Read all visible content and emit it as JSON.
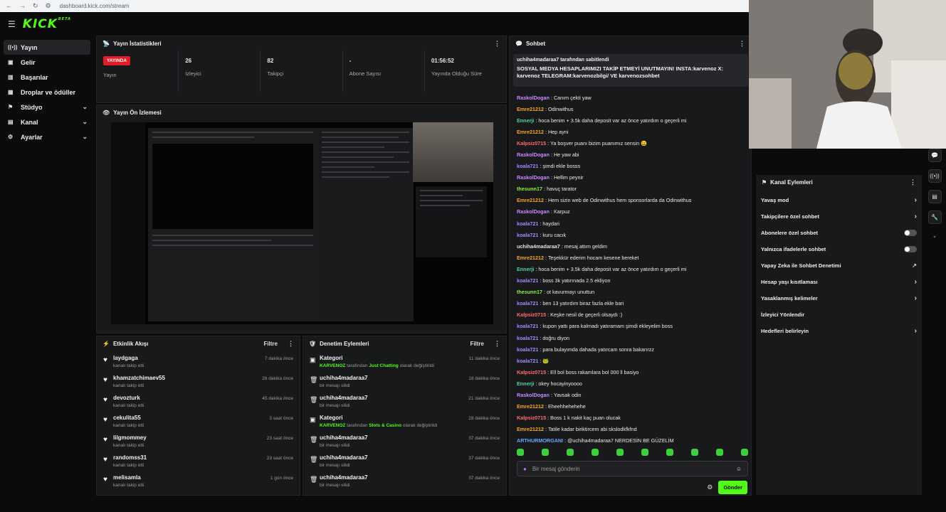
{
  "browser": {
    "url": "dashboard.kick.com/stream"
  },
  "brand": {
    "logo": "KICK",
    "beta": "BETA"
  },
  "sidebar": {
    "items": [
      {
        "label": "Yayın",
        "icon": "broadcast-icon",
        "chevron": false,
        "active": true
      },
      {
        "label": "Gelir",
        "icon": "revenue-icon",
        "chevron": false
      },
      {
        "label": "Başarılar",
        "icon": "chart-icon",
        "chevron": false
      },
      {
        "label": "Droplar ve ödüller",
        "icon": "drops-icon",
        "chevron": false
      },
      {
        "label": "Stüdyo",
        "icon": "studio-icon",
        "chevron": true
      },
      {
        "label": "Kanal",
        "icon": "channel-icon",
        "chevron": true
      },
      {
        "label": "Ayarlar",
        "icon": "gear-icon",
        "chevron": true
      }
    ]
  },
  "stats": {
    "title": "Yayın İstatistikleri",
    "items": [
      {
        "value": "YAYINDA",
        "label": "Yayın",
        "badge": true
      },
      {
        "value": "26",
        "label": "İzleyici"
      },
      {
        "value": "82",
        "label": "Takipçi"
      },
      {
        "value": "-",
        "label": "Abone Sayısı"
      },
      {
        "value": "01:56:52",
        "label": "Yayında Olduğu Süre"
      }
    ]
  },
  "preview": {
    "title": "Yayın Ön İzlemesi"
  },
  "activity": {
    "title": "Etkinlik Akışı",
    "filter": "Filtre",
    "rows": [
      {
        "name": "laydgaga",
        "action": "kanalı takip etti",
        "time": "7 dakika önce"
      },
      {
        "name": "khamzatchimaev55",
        "action": "kanalı takip etti",
        "time": "26 dakika önce"
      },
      {
        "name": "devozturk",
        "action": "kanalı takip etti",
        "time": "45 dakika önce"
      },
      {
        "name": "cekulita55",
        "action": "kanalı takip etti",
        "time": "3 saat önce"
      },
      {
        "name": "lilgmommey",
        "action": "kanalı takip etti",
        "time": "23 saat önce"
      },
      {
        "name": "randomss31",
        "action": "kanalı takip etti",
        "time": "23 saat önce"
      },
      {
        "name": "melisamla",
        "action": "kanalı takip etti",
        "time": "1 gün önce"
      }
    ]
  },
  "moderation": {
    "title": "Denetim Eylemleri",
    "filter": "Filtre",
    "rows": [
      {
        "name": "Kategori",
        "icon": "category-icon",
        "pre": "KARVENOZ",
        "mid": " tarafından ",
        "hl": "Just Chatting",
        "post": " olarak değiştirildi",
        "time": "11 dakika önce"
      },
      {
        "name": "uchiha4madaraa7",
        "icon": "trash-icon",
        "pre": "",
        "mid": "bir mesajı silidi",
        "hl": "",
        "post": "",
        "time": "18 dakika önce"
      },
      {
        "name": "uchiha4madaraa7",
        "icon": "trash-icon",
        "pre": "",
        "mid": "bir mesajı silidi",
        "hl": "",
        "post": "",
        "time": "21 dakika önce"
      },
      {
        "name": "Kategori",
        "icon": "category-icon",
        "pre": "KARVENOZ",
        "mid": " tarafından ",
        "hl": "Slots & Casino",
        "post": " olarak değiştirildi",
        "time": "28 dakika önce"
      },
      {
        "name": "uchiha4madaraa7",
        "icon": "trash-icon",
        "pre": "",
        "mid": "bir mesajı silidi",
        "hl": "",
        "post": "",
        "time": "37 dakika önce"
      },
      {
        "name": "uchiha4madaraa7",
        "icon": "trash-icon",
        "pre": "",
        "mid": "bir mesajı silidi",
        "hl": "",
        "post": "",
        "time": "37 dakika önce"
      },
      {
        "name": "uchiha4madaraa7",
        "icon": "trash-icon",
        "pre": "",
        "mid": "bir mesajı silidi",
        "hl": "",
        "post": "",
        "time": "37 dakika önce"
      }
    ]
  },
  "chat": {
    "title": "Sohbet",
    "pinned": {
      "by": "uchiha4madaraa7 tarafından sabitlendi",
      "message": "SOSYAL MEDYA HESAPLARIMIZI TAKİP ETMEYİ UNUTMAYIN! INSTA:karvenoz X: karvenoz TELEGRAM:karvenozbilgi/ VE karvenozsohbet"
    },
    "messages": [
      {
        "user": "RaskolDogan",
        "color": "#c98bff",
        "text": "Canım çekti yaw"
      },
      {
        "user": "Emre21212",
        "color": "#f5a623",
        "text": "Odinwithus"
      },
      {
        "user": "Ennerji",
        "color": "#4cd6a0",
        "text": "hoca benim + 3.5k daha deposit var az önce yatırdım o geçerli mi"
      },
      {
        "user": "Emre21212",
        "color": "#f5a623",
        "text": "Hep ayni"
      },
      {
        "user": "Kalpsiz0715",
        "color": "#ff6b6b",
        "text": "Ya boşver puanı bizim puanımız sensin 😀"
      },
      {
        "user": "RaskolDogan",
        "color": "#c98bff",
        "text": "He yaw abi"
      },
      {
        "user": "koala721",
        "color": "#9b8cff",
        "text": "şimdi ekle bosss"
      },
      {
        "user": "RaskolDogan",
        "color": "#c98bff",
        "text": "Hellim peynir"
      },
      {
        "user": "thesunn17",
        "color": "#8cf03c",
        "text": "havuç tarator"
      },
      {
        "user": "Emre21212",
        "color": "#f5a623",
        "text": "Hem sizin web de Odinwithus hem sponsorlarda da Odinwithus"
      },
      {
        "user": "RaskolDogan",
        "color": "#c98bff",
        "text": "Karpuz"
      },
      {
        "user": "koala721",
        "color": "#9b8cff",
        "text": "haydari"
      },
      {
        "user": "koala721",
        "color": "#9b8cff",
        "text": "kuru cacık"
      },
      {
        "user": "uchiha4madaraa7",
        "color": "#e0e0e0",
        "text": "mesaj attım geldim"
      },
      {
        "user": "Emre21212",
        "color": "#f5a623",
        "text": "Teşekkür ederim hocam kesene bereket"
      },
      {
        "user": "Ennerji",
        "color": "#4cd6a0",
        "text": "hoca benim + 3.5k daha deposit var az önce yatırdım o geçerli mi"
      },
      {
        "user": "koala721",
        "color": "#9b8cff",
        "text": "boss 3k yatırınada 2.5 ekliyon"
      },
      {
        "user": "thesunn17",
        "color": "#8cf03c",
        "text": "ot kavurmayı unuttun"
      },
      {
        "user": "koala721",
        "color": "#9b8cff",
        "text": "ben 13 yatırdım biraz fazla ekle bari"
      },
      {
        "user": "Kalpsiz0715",
        "color": "#ff6b6b",
        "text": "Keşke nesil de geçerli olsaydı :)"
      },
      {
        "user": "koala721",
        "color": "#9b8cff",
        "text": "kupon yattı para kalmadı yatıramam şimdi ekleyelim boss"
      },
      {
        "user": "koala721",
        "color": "#9b8cff",
        "text": "doğru diyon"
      },
      {
        "user": "koala721",
        "color": "#9b8cff",
        "text": "para bulayımda dahada yatırcam sonra bakarırzz"
      },
      {
        "user": "koala721",
        "color": "#9b8cff",
        "text": "🐸"
      },
      {
        "user": "Kalpsiz0715",
        "color": "#ff6b6b",
        "text": "Ell bol boss rakamlara bol 000 ll basiyo"
      },
      {
        "user": "Ennerji",
        "color": "#4cd6a0",
        "text": "okey hocayinyoooo"
      },
      {
        "user": "RaskolDogan",
        "color": "#c98bff",
        "text": "Yavsak odin"
      },
      {
        "user": "Emre21212",
        "color": "#f5a623",
        "text": "Eheehhehehehe"
      },
      {
        "user": "Kalpsiz0715",
        "color": "#ff6b6b",
        "text": "Boss 1 k nakit kaç puan olucak"
      },
      {
        "user": "Emre21212",
        "color": "#f5a623",
        "text": "Tatile kadar biriktircem abi skslodkfkfnd"
      },
      {
        "user": "ARTHURMORGANI",
        "color": "#6aa8ff",
        "text": "@uchiha4madaraa7 NERDESİN BE GÜZELİM"
      }
    ],
    "placeholder": "Bir mesaj gönderin",
    "send": "Gönder"
  },
  "actions": {
    "title": "Kanal Eylemleri",
    "rows": [
      {
        "label": "Yavaş mod",
        "type": "arrow"
      },
      {
        "label": "Takipçilere özel sohbet",
        "type": "arrow"
      },
      {
        "label": "Abonelere özel sohbet",
        "type": "toggle"
      },
      {
        "label": "Yalnızca ifadelerle sohbet",
        "type": "toggle"
      },
      {
        "label": "Yapay Zeka ile Sohbet Denetimi",
        "type": "ext"
      },
      {
        "label": "Hesap yaşı kısıtlaması",
        "type": "arrow"
      },
      {
        "label": "Yasaklanmış kelimeler",
        "type": "arrow"
      },
      {
        "label": "İzleyici Yönlendir",
        "type": "none"
      },
      {
        "label": "Hedefleri belirleyin",
        "type": "arrow"
      }
    ]
  }
}
